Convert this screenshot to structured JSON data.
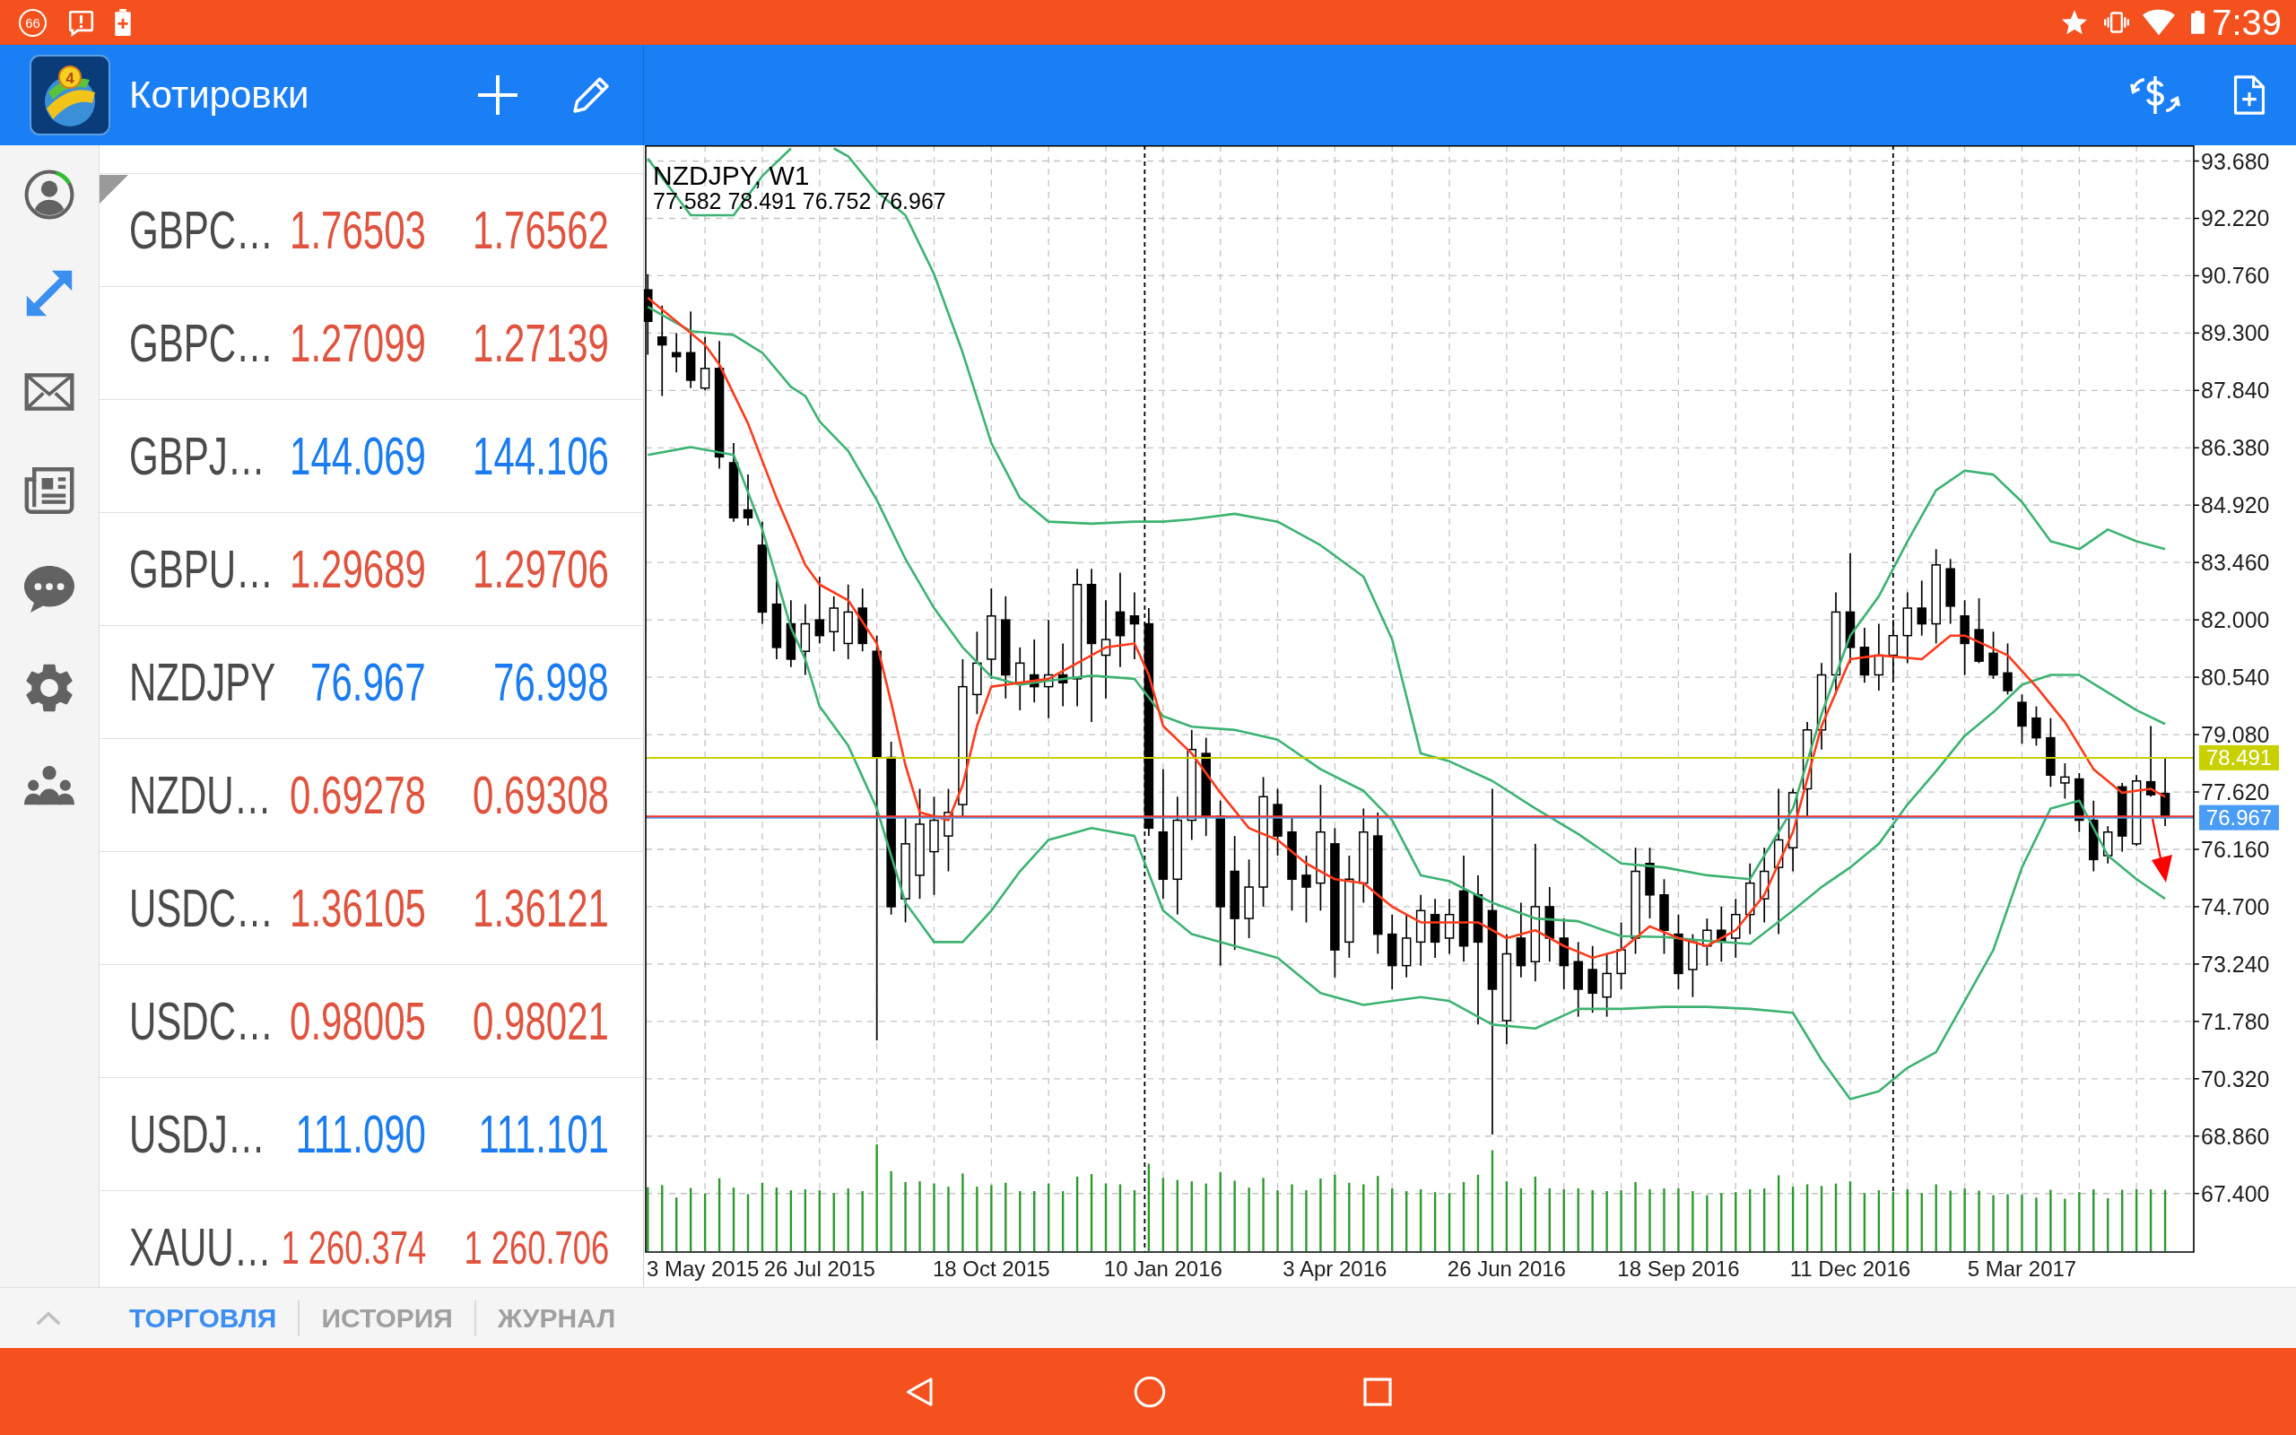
{
  "status_bar": {
    "notification_count": "66",
    "time": "7:39"
  },
  "app_bar": {
    "logo_badge": "4",
    "title": "Котировки"
  },
  "sidebar": {
    "items": [
      {
        "kind": "account",
        "selected": false
      },
      {
        "kind": "trade",
        "selected": true
      },
      {
        "kind": "mail",
        "selected": false
      },
      {
        "kind": "news",
        "selected": false
      },
      {
        "kind": "chat",
        "selected": false
      },
      {
        "kind": "settings",
        "selected": false
      },
      {
        "kind": "community",
        "selected": false
      }
    ]
  },
  "quotes": [
    {
      "symbol": "GBPC…",
      "bid": "1.76503",
      "ask": "1.76562",
      "color": "#e0533f"
    },
    {
      "symbol": "GBPC…",
      "bid": "1.27099",
      "ask": "1.27139",
      "color": "#e0533f"
    },
    {
      "symbol": "GBPJ…",
      "bid": "144.069",
      "ask": "144.106",
      "color": "#1a7cf0"
    },
    {
      "symbol": "GBPU…",
      "bid": "1.29689",
      "ask": "1.29706",
      "color": "#e0533f"
    },
    {
      "symbol": "NZDJPY",
      "bid": "76.967",
      "ask": "76.998",
      "color": "#1a7cf0"
    },
    {
      "symbol": "NZDU…",
      "bid": "0.69278",
      "ask": "0.69308",
      "color": "#e0533f"
    },
    {
      "symbol": "USDC…",
      "bid": "1.36105",
      "ask": "1.36121",
      "color": "#e0533f"
    },
    {
      "symbol": "USDC…",
      "bid": "0.98005",
      "ask": "0.98021",
      "color": "#e0533f"
    },
    {
      "symbol": "USDJ…",
      "bid": "111.090",
      "ask": "111.101",
      "color": "#1a7cf0"
    },
    {
      "symbol": "XAUU…",
      "bid": "1 260.374",
      "ask": "1 260.706",
      "color": "#e0533f"
    }
  ],
  "chart": {
    "chart_data": [
      {
        "type": "candlestick",
        "title": "NZDJPY, W1",
        "subtitle": "77.582 78.491 76.752 76.967",
        "x": [
          "2015-05-03",
          "2015-05-10",
          "2015-05-17",
          "2015-05-24",
          "2015-05-31",
          "2015-06-07",
          "2015-06-14",
          "2015-06-21",
          "2015-06-28",
          "2015-07-05",
          "2015-07-12",
          "2015-07-19",
          "2015-07-26",
          "2015-08-02",
          "2015-08-09",
          "2015-08-16",
          "2015-08-23",
          "2015-08-30",
          "2015-09-06",
          "2015-09-13",
          "2015-09-20",
          "2015-09-27",
          "2015-10-04",
          "2015-10-11",
          "2015-10-18",
          "2015-10-25",
          "2015-11-01",
          "2015-11-08",
          "2015-11-15",
          "2015-11-22",
          "2015-11-29",
          "2015-12-06",
          "2015-12-13",
          "2015-12-20",
          "2015-12-27",
          "2016-01-03",
          "2016-01-10",
          "2016-01-17",
          "2016-01-24",
          "2016-01-31",
          "2016-02-07",
          "2016-02-14",
          "2016-02-21",
          "2016-02-28",
          "2016-03-06",
          "2016-03-13",
          "2016-03-20",
          "2016-03-27",
          "2016-04-03",
          "2016-04-10",
          "2016-04-17",
          "2016-04-24",
          "2016-05-01",
          "2016-05-08",
          "2016-05-15",
          "2016-05-22",
          "2016-05-29",
          "2016-06-05",
          "2016-06-12",
          "2016-06-19",
          "2016-06-26",
          "2016-07-03",
          "2016-07-10",
          "2016-07-17",
          "2016-07-24",
          "2016-07-31",
          "2016-08-07",
          "2016-08-14",
          "2016-08-21",
          "2016-08-28",
          "2016-09-04",
          "2016-09-11",
          "2016-09-18",
          "2016-09-25",
          "2016-10-02",
          "2016-10-09",
          "2016-10-16",
          "2016-10-23",
          "2016-10-30",
          "2016-11-06",
          "2016-11-13",
          "2016-11-20",
          "2016-11-27",
          "2016-12-04",
          "2016-12-11",
          "2016-12-18",
          "2016-12-25",
          "2017-01-01",
          "2017-01-08",
          "2017-01-15",
          "2017-01-22",
          "2017-01-29",
          "2017-02-05",
          "2017-02-12",
          "2017-02-19",
          "2017-02-26",
          "2017-03-05",
          "2017-03-12",
          "2017-03-19",
          "2017-03-26",
          "2017-04-02",
          "2017-04-09",
          "2017-04-16",
          "2017-04-23",
          "2017-04-30",
          "2017-05-07",
          "2017-05-14"
        ],
        "ohlc": [
          [
            90.4,
            90.8,
            88.75,
            89.6
          ],
          [
            89.2,
            90.0,
            87.7,
            89.0
          ],
          [
            88.8,
            89.3,
            88.3,
            88.7
          ],
          [
            88.8,
            89.85,
            87.9,
            88.1
          ],
          [
            87.9,
            89.2,
            87.85,
            88.4
          ],
          [
            88.4,
            89.1,
            85.85,
            86.15
          ],
          [
            86.0,
            86.5,
            84.5,
            84.6
          ],
          [
            84.8,
            85.7,
            84.4,
            84.6
          ],
          [
            83.9,
            84.5,
            81.9,
            82.2
          ],
          [
            82.4,
            83.0,
            81.0,
            81.3
          ],
          [
            81.9,
            82.5,
            80.8,
            81.0
          ],
          [
            81.2,
            82.4,
            80.6,
            81.9
          ],
          [
            82.0,
            83.1,
            81.4,
            81.6
          ],
          [
            81.7,
            82.6,
            81.2,
            82.3
          ],
          [
            81.4,
            82.9,
            81.0,
            82.2
          ],
          [
            82.3,
            82.8,
            81.2,
            81.4
          ],
          [
            81.2,
            81.6,
            71.3,
            78.5
          ],
          [
            78.5,
            78.9,
            74.5,
            74.7
          ],
          [
            74.9,
            77.0,
            74.3,
            76.3
          ],
          [
            75.5,
            77.7,
            74.9,
            76.8
          ],
          [
            76.1,
            77.5,
            75.0,
            76.9
          ],
          [
            76.5,
            77.7,
            75.6,
            77.1
          ],
          [
            77.3,
            81.0,
            77.0,
            80.3
          ],
          [
            80.1,
            81.7,
            79.6,
            80.9
          ],
          [
            81.0,
            82.8,
            80.5,
            82.1
          ],
          [
            82.0,
            82.6,
            80.0,
            80.6
          ],
          [
            80.4,
            81.3,
            79.7,
            80.9
          ],
          [
            80.6,
            81.5,
            79.9,
            80.3
          ],
          [
            80.3,
            82.0,
            79.5,
            80.6
          ],
          [
            80.6,
            81.4,
            79.8,
            80.4
          ],
          [
            80.5,
            83.3,
            79.8,
            82.9
          ],
          [
            82.9,
            83.3,
            79.4,
            81.4
          ],
          [
            81.1,
            82.5,
            80.0,
            81.5
          ],
          [
            82.2,
            83.2,
            80.8,
            81.6
          ],
          [
            82.1,
            82.7,
            81.0,
            81.9
          ],
          [
            81.9,
            82.3,
            76.5,
            76.7
          ],
          [
            76.6,
            78.2,
            74.9,
            75.4
          ],
          [
            75.4,
            77.5,
            74.5,
            76.9
          ],
          [
            76.9,
            79.2,
            76.4,
            78.7
          ],
          [
            78.6,
            79.0,
            76.5,
            77.0
          ],
          [
            77.0,
            77.4,
            73.2,
            74.7
          ],
          [
            75.6,
            76.5,
            73.6,
            74.4
          ],
          [
            74.4,
            75.9,
            73.9,
            75.2
          ],
          [
            75.2,
            78.0,
            74.7,
            77.5
          ],
          [
            77.3,
            77.7,
            76.0,
            76.5
          ],
          [
            76.6,
            77.0,
            74.6,
            75.4
          ],
          [
            75.5,
            76.0,
            74.3,
            75.2
          ],
          [
            75.3,
            77.8,
            74.6,
            76.6
          ],
          [
            76.3,
            76.7,
            72.9,
            73.6
          ],
          [
            73.8,
            76.0,
            73.4,
            75.4
          ],
          [
            75.3,
            77.2,
            74.8,
            76.6
          ],
          [
            76.5,
            77.1,
            73.5,
            74.0
          ],
          [
            74.0,
            74.5,
            72.6,
            73.2
          ],
          [
            73.2,
            74.5,
            72.9,
            73.9
          ],
          [
            73.8,
            75.0,
            73.2,
            74.6
          ],
          [
            74.5,
            74.9,
            73.4,
            73.8
          ],
          [
            73.9,
            74.9,
            73.5,
            74.5
          ],
          [
            75.1,
            76.0,
            73.3,
            73.7
          ],
          [
            75.0,
            75.5,
            71.7,
            73.8
          ],
          [
            74.6,
            77.7,
            68.9,
            72.6
          ],
          [
            71.8,
            74.0,
            71.2,
            73.5
          ],
          [
            73.9,
            74.8,
            72.9,
            73.2
          ],
          [
            73.3,
            76.3,
            72.8,
            74.7
          ],
          [
            74.7,
            75.2,
            73.3,
            73.9
          ],
          [
            73.9,
            74.4,
            72.6,
            73.2
          ],
          [
            73.3,
            73.8,
            71.9,
            72.6
          ],
          [
            73.1,
            73.7,
            72.0,
            72.5
          ],
          [
            72.4,
            73.5,
            71.9,
            73.0
          ],
          [
            73.0,
            74.3,
            72.6,
            73.6
          ],
          [
            73.9,
            76.2,
            73.5,
            75.6
          ],
          [
            75.8,
            76.2,
            74.4,
            75.0
          ],
          [
            75.0,
            75.4,
            73.5,
            74.1
          ],
          [
            74.0,
            74.5,
            72.6,
            73.0
          ],
          [
            73.1,
            74.0,
            72.4,
            73.8
          ],
          [
            73.7,
            74.4,
            73.2,
            74.1
          ],
          [
            74.1,
            74.7,
            73.3,
            73.8
          ],
          [
            73.9,
            74.9,
            73.4,
            74.5
          ],
          [
            74.5,
            75.8,
            74.0,
            75.3
          ],
          [
            74.9,
            76.2,
            74.3,
            75.6
          ],
          [
            75.7,
            77.7,
            74.0,
            76.4
          ],
          [
            76.2,
            77.7,
            75.6,
            77.6
          ],
          [
            77.7,
            79.4,
            77.0,
            79.2
          ],
          [
            79.2,
            80.9,
            78.7,
            80.6
          ],
          [
            80.6,
            82.7,
            80.2,
            82.2
          ],
          [
            82.2,
            83.7,
            80.9,
            81.3
          ],
          [
            81.3,
            81.8,
            80.4,
            80.6
          ],
          [
            80.6,
            81.9,
            80.2,
            81.1
          ],
          [
            81.1,
            82.0,
            80.5,
            81.6
          ],
          [
            81.6,
            82.7,
            80.9,
            82.3
          ],
          [
            82.3,
            83.0,
            81.6,
            81.9
          ],
          [
            81.9,
            83.8,
            81.4,
            83.4
          ],
          [
            83.3,
            83.55,
            81.9,
            82.35
          ],
          [
            82.1,
            82.5,
            80.6,
            81.4
          ],
          [
            81.75,
            82.55,
            80.9,
            80.95
          ],
          [
            81.15,
            81.7,
            80.5,
            80.6
          ],
          [
            80.65,
            81.4,
            80.1,
            80.2
          ],
          [
            79.9,
            80.1,
            78.85,
            79.3
          ],
          [
            79.5,
            79.8,
            78.8,
            79.0
          ],
          [
            79.0,
            79.5,
            77.75,
            78.05
          ],
          [
            77.85,
            78.35,
            77.45,
            78.0
          ],
          [
            77.95,
            78.1,
            76.6,
            76.9
          ],
          [
            76.9,
            77.4,
            75.6,
            75.9
          ],
          [
            76.0,
            76.75,
            75.8,
            76.6
          ],
          [
            77.75,
            77.85,
            76.1,
            76.5
          ],
          [
            76.3,
            78.05,
            76.25,
            77.9
          ],
          [
            77.88,
            79.3,
            77.5,
            77.55
          ],
          [
            77.582,
            78.491,
            76.752,
            76.967
          ]
        ],
        "series": [
          {
            "type": "line",
            "color": "#3cb371",
            "x": [
              "2015-05-03",
              "2015-05-24",
              "2015-06-14",
              "2015-06-28",
              "2015-07-12"
            ],
            "values": [
              93.74,
              92.3,
              92.3,
              93.3,
              94.0
            ]
          },
          {
            "type": "line",
            "color": "#3cb371",
            "x": [
              "2015-08-02",
              "2015-08-09",
              "2015-08-23",
              "2015-09-06",
              "2015-09-20",
              "2015-10-04",
              "2015-10-18",
              "2015-11-01",
              "2015-11-15",
              "2015-12-06",
              "2015-12-27",
              "2016-01-10",
              "2016-01-24",
              "2016-02-14",
              "2016-03-06",
              "2016-03-27",
              "2016-04-17",
              "2016-05-01",
              "2016-05-15",
              "2016-05-29",
              "2016-06-19",
              "2016-07-10",
              "2016-07-31",
              "2016-08-21",
              "2016-09-11",
              "2016-10-02",
              "2016-10-23",
              "2016-11-13",
              "2016-11-27",
              "2016-12-11",
              "2016-12-25",
              "2017-01-08",
              "2017-01-22",
              "2017-02-05",
              "2017-02-19",
              "2017-03-05",
              "2017-03-19",
              "2017-04-02",
              "2017-04-16",
              "2017-04-30",
              "2017-05-14"
            ],
            "values": [
              94.0,
              93.8,
              92.9,
              92.3,
              90.8,
              88.8,
              86.5,
              85.1,
              84.5,
              84.45,
              84.5,
              84.5,
              84.56,
              84.7,
              84.5,
              83.9,
              83.1,
              81.5,
              78.6,
              78.4,
              77.9,
              77.2,
              76.55,
              75.8,
              75.7,
              75.5,
              75.4,
              77.2,
              79.6,
              81.6,
              82.6,
              84.0,
              85.3,
              85.8,
              85.7,
              85.0,
              84.0,
              83.8,
              84.3,
              84.0,
              83.8
            ]
          },
          {
            "type": "line",
            "color": "#3cb371",
            "x": [
              "2015-05-03",
              "2015-05-24",
              "2015-06-14",
              "2015-06-28",
              "2015-07-12",
              "2015-07-19",
              "2015-07-26",
              "2015-08-09",
              "2015-08-23",
              "2015-09-06",
              "2015-09-20",
              "2015-10-04",
              "2015-10-18",
              "2015-11-01",
              "2015-11-15",
              "2015-12-06",
              "2015-12-27",
              "2016-01-10",
              "2016-01-24",
              "2016-02-14",
              "2016-03-06",
              "2016-03-27",
              "2016-04-17",
              "2016-05-01",
              "2016-05-15",
              "2016-05-29",
              "2016-06-19",
              "2016-07-10",
              "2016-07-31",
              "2016-08-21",
              "2016-09-11",
              "2016-10-02",
              "2016-10-23",
              "2016-11-13",
              "2016-11-27",
              "2016-12-11",
              "2016-12-25",
              "2017-01-08",
              "2017-01-22",
              "2017-02-05",
              "2017-02-19",
              "2017-03-05",
              "2017-03-19",
              "2017-04-02",
              "2017-04-16",
              "2017-04-30",
              "2017-05-14"
            ],
            "values": [
              89.97,
              89.35,
              89.25,
              88.8,
              87.93,
              87.7,
              87.05,
              86.3,
              85.05,
              83.55,
              82.3,
              81.3,
              80.55,
              80.35,
              80.45,
              80.58,
              80.5,
              79.55,
              79.28,
              79.2,
              78.95,
              78.2,
              77.65,
              76.9,
              75.5,
              75.35,
              74.8,
              74.4,
              74.33,
              73.95,
              73.93,
              73.83,
              73.75,
              74.6,
              75.2,
              75.7,
              76.3,
              77.3,
              78.15,
              79.05,
              79.65,
              80.35,
              80.6,
              80.6,
              80.15,
              79.7,
              79.35
            ]
          },
          {
            "type": "line",
            "color": "#3cb371",
            "x": [
              "2015-05-03",
              "2015-05-24",
              "2015-06-14",
              "2015-06-28",
              "2015-07-12",
              "2015-07-19",
              "2015-07-26",
              "2015-08-09",
              "2015-08-23",
              "2015-09-06",
              "2015-09-20",
              "2015-10-04",
              "2015-10-18",
              "2015-11-01",
              "2015-11-15",
              "2015-12-06",
              "2015-12-27",
              "2016-01-10",
              "2016-01-24",
              "2016-02-14",
              "2016-03-06",
              "2016-03-27",
              "2016-04-17",
              "2016-05-01",
              "2016-05-15",
              "2016-05-29",
              "2016-06-19",
              "2016-07-10",
              "2016-07-31",
              "2016-08-21",
              "2016-09-11",
              "2016-10-02",
              "2016-10-23",
              "2016-11-13",
              "2016-11-27",
              "2016-12-11",
              "2016-12-25",
              "2017-01-08",
              "2017-01-22",
              "2017-02-05",
              "2017-02-19",
              "2017-03-05",
              "2017-03-19",
              "2017-04-02",
              "2017-04-16",
              "2017-04-30",
              "2017-05-14"
            ],
            "values": [
              86.2,
              86.4,
              86.2,
              84.3,
              81.8,
              81.0,
              79.8,
              78.8,
              77.2,
              74.8,
              73.8,
              73.8,
              74.6,
              75.6,
              76.4,
              76.7,
              76.5,
              74.6,
              74.0,
              73.7,
              73.4,
              72.5,
              72.2,
              72.3,
              72.4,
              72.3,
              71.7,
              71.6,
              72.1,
              72.1,
              72.15,
              72.15,
              72.1,
              72.0,
              70.8,
              69.8,
              70.0,
              70.6,
              71.0,
              72.3,
              73.6,
              75.7,
              77.2,
              77.4,
              76.0,
              75.4,
              74.9
            ]
          },
          {
            "type": "line",
            "color": "#ff3a1a",
            "x": [
              "2015-05-03",
              "2015-05-31",
              "2015-06-07",
              "2015-06-21",
              "2015-07-05",
              "2015-07-19",
              "2015-07-26",
              "2015-08-09",
              "2015-08-23",
              "2015-08-30",
              "2015-09-06",
              "2015-09-13",
              "2015-09-27",
              "2015-10-04",
              "2015-10-11",
              "2015-10-18",
              "2015-11-15",
              "2015-12-13",
              "2015-12-27",
              "2016-01-03",
              "2016-01-10",
              "2016-01-24",
              "2016-02-07",
              "2016-02-21",
              "2016-03-06",
              "2016-03-20",
              "2016-04-03",
              "2016-04-17",
              "2016-05-01",
              "2016-05-15",
              "2016-06-12",
              "2016-06-26",
              "2016-07-10",
              "2016-07-24",
              "2016-08-07",
              "2016-08-21",
              "2016-09-04",
              "2016-09-18",
              "2016-10-02",
              "2016-10-16",
              "2016-10-30",
              "2016-11-13",
              "2016-11-27",
              "2016-12-11",
              "2016-12-25",
              "2017-01-15",
              "2017-01-29",
              "2017-02-05",
              "2017-02-26",
              "2017-03-12",
              "2017-03-26",
              "2017-04-09",
              "2017-04-23",
              "2017-05-07",
              "2017-05-14"
            ],
            "values": [
              90.2,
              89.0,
              88.5,
              87.0,
              85.1,
              83.4,
              82.9,
              82.5,
              81.4,
              79.9,
              78.3,
              77.1,
              76.9,
              77.8,
              79.3,
              80.3,
              80.5,
              81.3,
              81.4,
              80.6,
              79.3,
              78.6,
              77.6,
              76.7,
              76.4,
              75.8,
              75.4,
              75.3,
              74.7,
              74.3,
              74.3,
              73.9,
              74.1,
              73.7,
              73.4,
              73.6,
              74.2,
              73.9,
              73.7,
              74.1,
              75.0,
              76.6,
              79.3,
              81.0,
              81.1,
              81.0,
              81.6,
              81.6,
              81.1,
              80.3,
              79.4,
              78.2,
              77.6,
              77.7,
              77.5
            ]
          }
        ],
        "xlim": [
          "2015-05-02",
          "2017-05-28"
        ],
        "ylim": [
          65.91,
          94.08
        ],
        "xticks": [
          {
            "value": "2015-07-26",
            "label": "26 Jul 2015"
          },
          {
            "value": "2015-10-18",
            "label": "18 Oct 2015"
          },
          {
            "value": "2016-01-10",
            "label": "10 Jan 2016"
          },
          {
            "value": "2016-04-03",
            "label": "3 Apr 2016"
          },
          {
            "value": "2016-06-26",
            "label": "26 Jun 2016"
          },
          {
            "value": "2016-09-18",
            "label": "18 Sep 2016"
          },
          {
            "value": "2016-12-11",
            "label": "11 Dec 2016"
          },
          {
            "value": "2017-03-05",
            "label": "5 Mar 2017"
          }
        ],
        "annotations": [
          "3 May 2015"
        ],
        "yticks": [
          {
            "value": 93.68,
            "label": "93.680"
          },
          {
            "value": 92.22,
            "label": "92.220"
          },
          {
            "value": 90.76,
            "label": "90.760"
          },
          {
            "value": 89.3,
            "label": "89.300"
          },
          {
            "value": 87.84,
            "label": "87.840"
          },
          {
            "value": 86.38,
            "label": "86.380"
          },
          {
            "value": 84.92,
            "label": "84.920"
          },
          {
            "value": 83.46,
            "label": "83.460"
          },
          {
            "value": 82.0,
            "label": "82.000"
          },
          {
            "value": 80.54,
            "label": "80.540"
          },
          {
            "value": 79.08,
            "label": "79.080"
          },
          {
            "value": 77.62,
            "label": "77.620"
          },
          {
            "value": 76.16,
            "label": "76.160"
          },
          {
            "value": 74.7,
            "label": "74.700"
          },
          {
            "value": 73.24,
            "label": "73.240"
          },
          {
            "value": 71.78,
            "label": "71.780"
          },
          {
            "value": 70.32,
            "label": "70.320"
          },
          {
            "value": 68.86,
            "label": "68.860"
          },
          {
            "value": 67.4,
            "label": "67.400"
          }
        ],
        "ref_lines": [
          {
            "axis": "x",
            "value": "2016-01-01",
            "color": "#000000",
            "line_style": "dashed"
          },
          {
            "axis": "x",
            "value": "2017-01-01",
            "color": "#000000",
            "line_style": "dashed"
          },
          {
            "axis": "y",
            "value": 78.491,
            "label": "78.491",
            "color": "#c8d000"
          },
          {
            "axis": "y",
            "value": 76.998,
            "color": "#f03a2a"
          },
          {
            "axis": "y",
            "value": 76.967,
            "label": "76.967",
            "color": "#4a9cf5"
          }
        ],
        "grid": true
      }
    ]
  },
  "bottom_tabs": [
    {
      "label": "ТОРГОВЛЯ",
      "selected": true
    },
    {
      "label": "ИСТОРИЯ",
      "selected": false
    },
    {
      "label": "ЖУРНАЛ",
      "selected": false
    }
  ]
}
